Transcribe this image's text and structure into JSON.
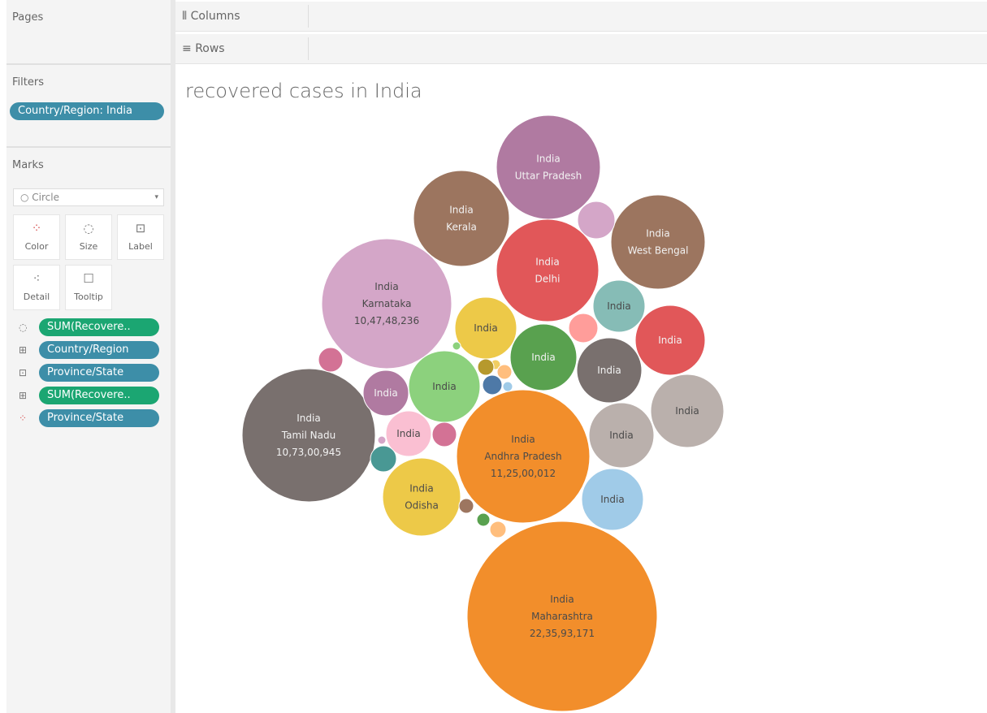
{
  "sidebar": {
    "pages_title": "Pages",
    "filters_title": "Filters",
    "filter_pill": "Country/Region: India",
    "marks_title": "Marks",
    "mark_type": "Circle",
    "mark_buttons": {
      "color": "Color",
      "size": "Size",
      "label": "Label",
      "detail": "Detail",
      "tooltip": "Tooltip"
    },
    "fields": [
      {
        "label": "SUM(Recovere..",
        "kind": "green",
        "icon": "size-icon"
      },
      {
        "label": "Country/Region",
        "kind": "blue",
        "icon": "detail-icon"
      },
      {
        "label": "Province/State",
        "kind": "blue",
        "icon": "label-icon"
      },
      {
        "label": "SUM(Recovere..",
        "kind": "green",
        "icon": "detail-icon"
      },
      {
        "label": "Province/State",
        "kind": "blue",
        "icon": "color-icon"
      }
    ]
  },
  "shelves": {
    "columns_label": "Columns",
    "rows_label": "Rows"
  },
  "chart_data": {
    "type": "bubble",
    "title": "recovered cases in India",
    "bubbles": [
      {
        "country": "India",
        "state": "Maharashtra",
        "value": "22,35,93,171",
        "color": "#f28e2b"
      },
      {
        "country": "India",
        "state": "Andhra Pradesh",
        "value": "11,25,00,012",
        "color": "#f28e2b"
      },
      {
        "country": "India",
        "state": "Tamil Nadu",
        "value": "10,73,00,945",
        "color": "#79706e"
      },
      {
        "country": "India",
        "state": "Karnataka",
        "value": "10,47,48,236",
        "color": "#d4a6c8"
      },
      {
        "country": "India",
        "state": "Uttar Pradesh",
        "color": "#b07aa1"
      },
      {
        "country": "India",
        "state": "Delhi",
        "color": "#e15759"
      },
      {
        "country": "India",
        "state": "Kerala",
        "color": "#9c755f"
      },
      {
        "country": "India",
        "state": "West Bengal",
        "color": "#9c755f"
      },
      {
        "country": "India",
        "state": "Odisha",
        "color": "#edc948"
      },
      {
        "country": "India",
        "color": "#bab0ac"
      },
      {
        "country": "India",
        "color": "#bab0ac"
      },
      {
        "country": "India",
        "color": "#e15759"
      },
      {
        "country": "India",
        "color": "#59a14f"
      },
      {
        "country": "India",
        "color": "#8cd17d"
      },
      {
        "country": "India",
        "color": "#edc948"
      },
      {
        "country": "India",
        "color": "#79706e"
      },
      {
        "country": "India",
        "color": "#86bcb6"
      },
      {
        "country": "India",
        "color": "#a0cbe8"
      },
      {
        "country": "India",
        "color": "#b07aa1"
      },
      {
        "country": "India",
        "color": "#fabfd2"
      },
      {
        "color": "#d4a6c8"
      },
      {
        "color": "#ff9d9a"
      },
      {
        "color": "#d37295"
      },
      {
        "color": "#d37295"
      },
      {
        "color": "#499894"
      },
      {
        "color": "#f1ce63"
      },
      {
        "color": "#4e79a7"
      },
      {
        "color": "#b6992d"
      },
      {
        "color": "#ffbe7d"
      },
      {
        "color": "#a0cbe8"
      },
      {
        "color": "#9d7660"
      },
      {
        "color": "#59a14f"
      },
      {
        "color": "#ffbe7d"
      },
      {
        "color": "#8cd17d"
      },
      {
        "color": "#d4a6c8"
      }
    ]
  }
}
